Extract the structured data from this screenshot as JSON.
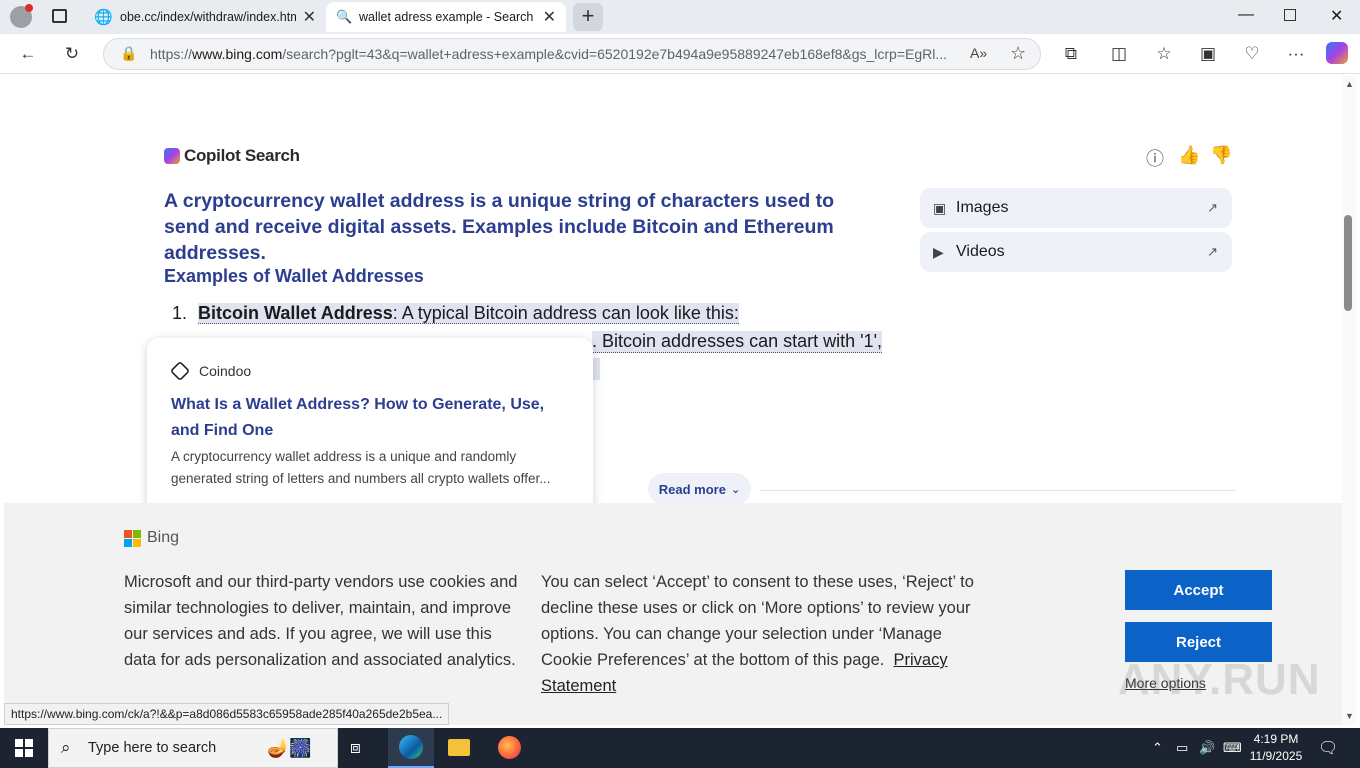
{
  "tabs": [
    {
      "title": "obe.cc/index/withdraw/index.htm"
    },
    {
      "title": "wallet adress example - Search"
    }
  ],
  "address_bar": {
    "url_prefix": "https://",
    "url_host": "www.bing.com",
    "url_rest": "/search?pglt=43&q=wallet+adress+example&cvid=6520192e7b494a9e95889247eb168ef8&gs_lcrp=EgRl..."
  },
  "copilot": {
    "brand": "Copilot Search",
    "answer": "A cryptocurrency wallet address is a unique string of characters used to send and receive digital assets. Examples include Bitcoin and Ethereum addresses.",
    "subheading": "Examples of Wallet Addresses",
    "item1_number": "1.",
    "item1_label": "Bitcoin Wallet Address",
    "item1_text": ": A typical Bitcoin address can look like this:",
    "item1_line2_text": ". Bitcoin addresses can start with '1',",
    "read_more": "Read more"
  },
  "side": {
    "images": "Images",
    "videos": "Videos"
  },
  "card": {
    "source": "Coindoo",
    "title": "What Is a Wallet Address? How to Generate, Use, and Find One",
    "snippet": "A cryptocurrency wallet address is a unique and randomly generated string of letters and numbers all crypto wallets offer..."
  },
  "cookie": {
    "brand": "Bing",
    "p1": "Microsoft and our third-party vendors use cookies and similar technologies to deliver, maintain, and improve our services and ads. If you agree, we will use this data for ads personalization and associated analytics.",
    "p2": "You can select ‘Accept’ to consent to these uses, ‘Reject’ to decline these uses or click on ‘More options’ to review your options. You can change your selection under ‘Manage Cookie Preferences’ at the bottom of this page.",
    "privacy": "Privacy Statement",
    "accept": "Accept",
    "reject": "Reject",
    "more_options": "More options"
  },
  "status_url": "https://www.bing.com/ck/a?!&&p=a8d086d5583c65958ade285f40a265de2b5ea...",
  "taskbar": {
    "search_placeholder": "Type here to search",
    "time": "4:19 PM",
    "date": "11/9/2025"
  },
  "watermark": "ANY.RUN",
  "colors": {
    "accent_blue": "#0b63c7",
    "heading_blue": "#2c3e8f",
    "taskbar": "#1c2432"
  }
}
